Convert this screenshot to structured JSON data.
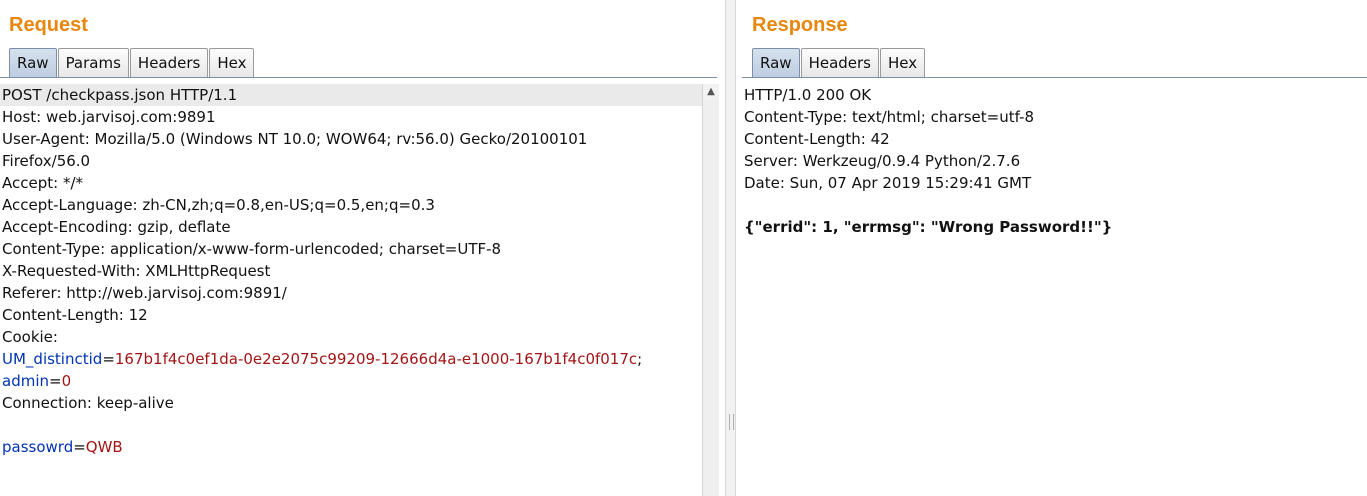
{
  "request": {
    "title": "Request",
    "tabs": [
      "Raw",
      "Params",
      "Headers",
      "Hex"
    ],
    "active_tab": "Raw",
    "lines": [
      "POST /checkpass.json HTTP/1.1",
      "Host: web.jarvisoj.com:9891",
      "User-Agent: Mozilla/5.0 (Windows NT 10.0; WOW64; rv:56.0) Gecko/20100101",
      "Firefox/56.0",
      "Accept: */*",
      "Accept-Language: zh-CN,zh;q=0.8,en-US;q=0.5,en;q=0.3",
      "Accept-Encoding: gzip, deflate",
      "Content-Type: application/x-www-form-urlencoded; charset=UTF-8",
      "X-Requested-With: XMLHttpRequest",
      "Referer: http://web.jarvisoj.com:9891/",
      "Content-Length: 12",
      "Cookie:"
    ],
    "cookie": [
      {
        "name": "UM_distinctid",
        "value": "167b1f4c0ef1da-0e2e2075c99209-12666d4a-e1000-167b1f4c0f017c",
        "sep": ";"
      },
      {
        "name": "admin",
        "value": "0",
        "sep": ""
      }
    ],
    "connection_line": "Connection: keep-alive",
    "body": {
      "name": "passowrd",
      "value": "QWB"
    },
    "scroll_up_glyph": "▲"
  },
  "response": {
    "title": "Response",
    "tabs": [
      "Raw",
      "Headers",
      "Hex"
    ],
    "active_tab": "Raw",
    "lines": [
      "HTTP/1.0 200 OK",
      "Content-Type: text/html; charset=utf-8",
      "Content-Length: 42",
      "Server: Werkzeug/0.9.4 Python/2.7.6",
      "Date: Sun, 07 Apr 2019 15:29:41 GMT"
    ],
    "body": "{\"errid\": 1, \"errmsg\": \"Wrong Password!!\"}"
  }
}
